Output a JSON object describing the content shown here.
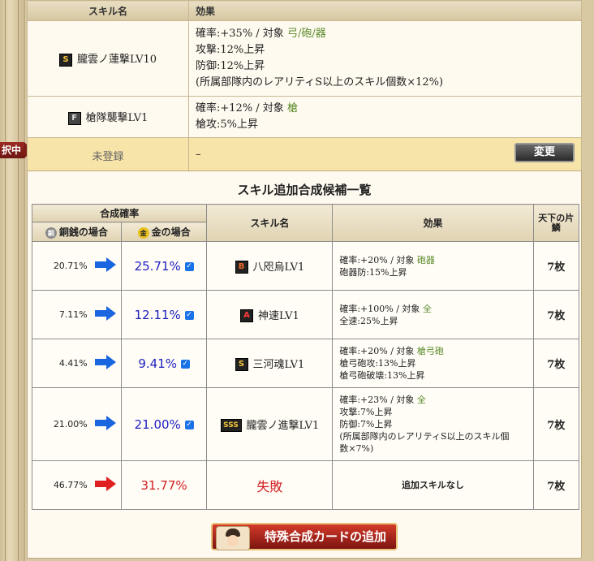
{
  "left_tab": "択中",
  "top_table": {
    "headers": [
      "スキル名",
      "効果"
    ],
    "rows": [
      {
        "badge": "S",
        "name": "朧雲ノ蓮撃LV10",
        "lines": [
          "確率:+35% / 対象 ",
          "攻撃:12%上昇",
          "防御:12%上昇",
          "(所属部隊内のレアリティS以上のスキル個数×12%)"
        ],
        "target": "弓/砲/器"
      },
      {
        "badge": "F",
        "name": "槍隊襲撃LV1",
        "lines": [
          "確率:+12% / 対象 ",
          "槍攻:5%上昇"
        ],
        "target": "槍"
      },
      {
        "name": "未登録",
        "effect": "–",
        "button": "変更"
      }
    ]
  },
  "panel": {
    "title": "スキル追加合成候補一覧",
    "headers": {
      "prob": "合成確率",
      "copper": "銅銭の場合",
      "gold": "金の場合",
      "skill": "スキル名",
      "effect": "効果",
      "count": "天下の片鱗"
    },
    "coin_copper": "銅",
    "coin_gold": "金",
    "rows": [
      {
        "base": "20.71%",
        "new": "25.71%",
        "badge": "B",
        "skill": "八咫烏LV1",
        "lines": [
          "確率:+20% / 対象 ",
          "砲器防:15%上昇"
        ],
        "target": "砲器",
        "count": "7枚"
      },
      {
        "base": "7.11%",
        "new": "12.11%",
        "badge": "A",
        "skill": "神速LV1",
        "lines": [
          "確率:+100% / 対象 ",
          "全速:25%上昇"
        ],
        "target": "全",
        "count": "7枚"
      },
      {
        "base": "4.41%",
        "new": "9.41%",
        "badge": "S",
        "skill": "三河魂LV1",
        "lines": [
          "確率:+20% / 対象 ",
          "槍弓砲攻:13%上昇",
          "槍弓砲破壊:13%上昇"
        ],
        "target": "槍弓砲",
        "count": "7枚"
      },
      {
        "base": "21.00%",
        "new": "21.00%",
        "badge": "SSS",
        "skill": "朧雲ノ進撃LV1",
        "lines": [
          "確率:+23% / 対象 ",
          "攻撃:7%上昇",
          "防御:7%上昇",
          "(所属部隊内のレアリティS以上のスキル個",
          "数×7%)"
        ],
        "target": "全",
        "count": "7枚"
      },
      {
        "base": "46.77%",
        "new": "31.77%",
        "skill": "失敗",
        "effect": "追加スキルなし",
        "count": "7枚"
      }
    ],
    "add_button": "特殊合成カードの追加"
  },
  "colors": {
    "target_green": "#5a8a2a",
    "prob_blue": "#2020c0",
    "fail_red": "#d42020",
    "arrow_blue": "#1a66e0",
    "arrow_red": "#e02020"
  }
}
